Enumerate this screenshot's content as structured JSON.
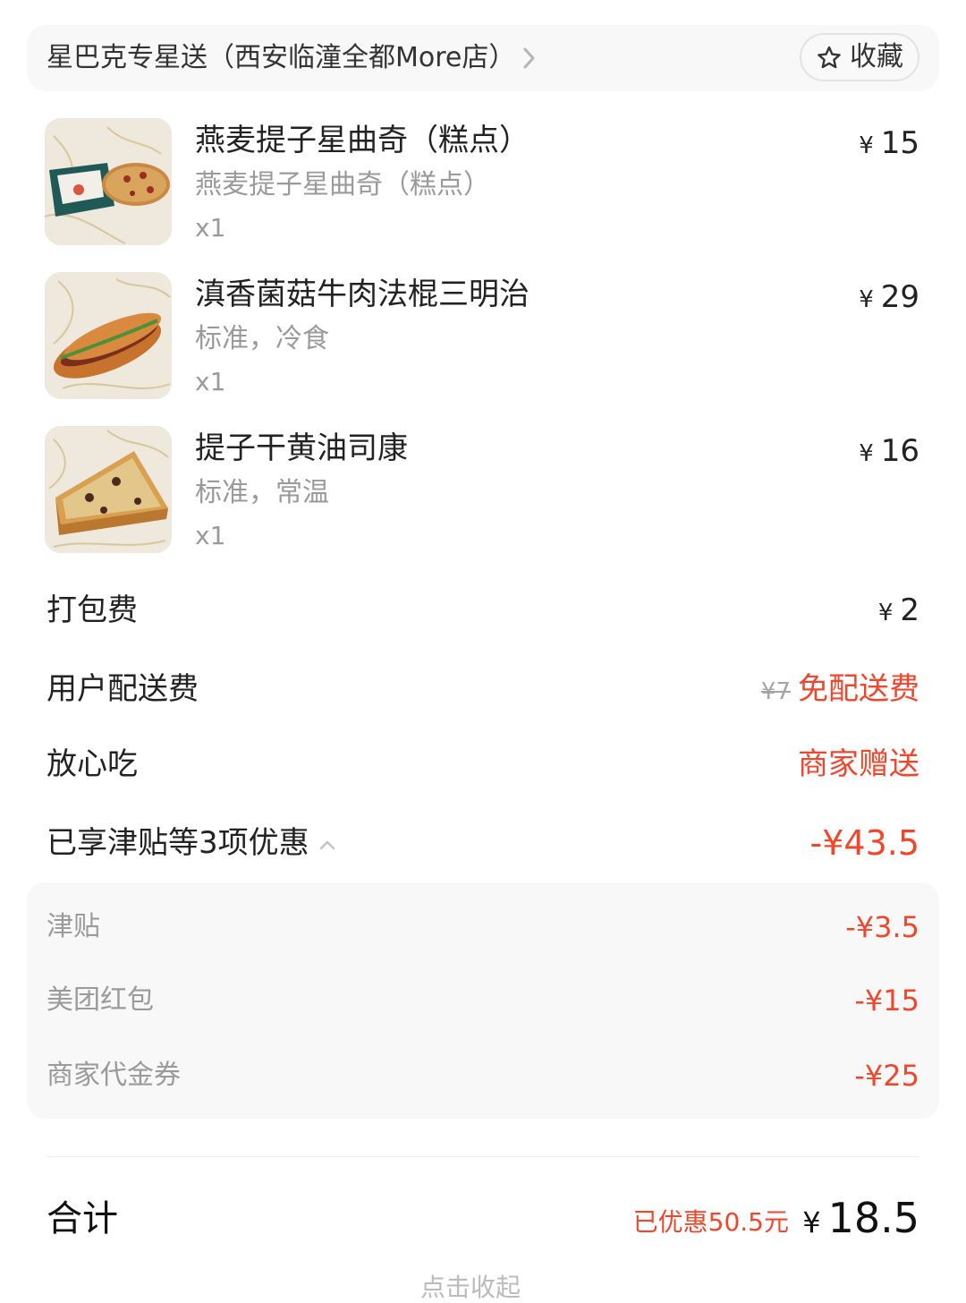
{
  "shop": {
    "name": "星巴克专星送（西安临潼全都More店）",
    "favorite_label": "收藏"
  },
  "items": [
    {
      "name": "燕麦提子星曲奇（糕点）",
      "spec": "燕麦提子星曲奇（糕点）",
      "qty": "x1",
      "currency": "¥",
      "price": "15",
      "icon": "cookie-image"
    },
    {
      "name": "滇香菌菇牛肉法棍三明治",
      "spec": "标准，冷食",
      "qty": "x1",
      "currency": "¥",
      "price": "29",
      "icon": "sandwich-image"
    },
    {
      "name": "提子干黄油司康",
      "spec": "标准，常温",
      "qty": "x1",
      "currency": "¥",
      "price": "16",
      "icon": "scone-image"
    }
  ],
  "fees": {
    "packing": {
      "label": "打包费",
      "currency": "¥",
      "value": "2"
    },
    "delivery": {
      "label": "用户配送费",
      "original": "¥7",
      "value": "免配送费"
    },
    "assurance": {
      "label": "放心吃",
      "value": "商家赠送"
    },
    "discount_summary": {
      "label": "已享津贴等3项优惠",
      "value": "-¥43.5"
    }
  },
  "discounts": [
    {
      "label": "津贴",
      "value": "-¥3.5"
    },
    {
      "label": "美团红包",
      "value": "-¥15"
    },
    {
      "label": "商家代金券",
      "value": "-¥25"
    }
  ],
  "summary": {
    "label": "合计",
    "saved": "已优惠50.5元",
    "currency": "¥",
    "total": "18.5",
    "collapse": "点击收起"
  },
  "colors": {
    "accent_red": "#f0462b",
    "muted_gray": "#9a9a9a",
    "panel_bg": "#f8f8f8"
  }
}
